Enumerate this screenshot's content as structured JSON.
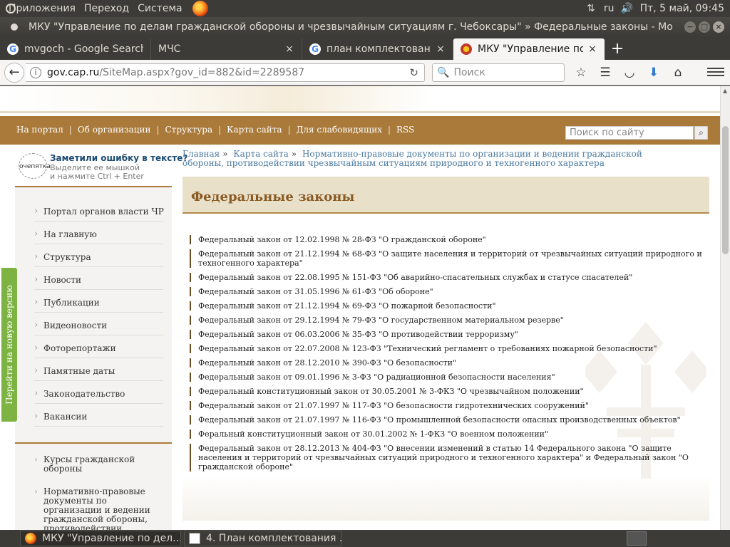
{
  "panel": {
    "menus": [
      "Приложения",
      "Переход",
      "Система"
    ],
    "lang": "ru",
    "datetime": "Пт, 5 май, 09:45"
  },
  "window": {
    "title": "МКУ \"Управление по делам гражданской обороны и чрезвычайным ситуациям г. Чебоксары\" » Федеральные законы - Mo"
  },
  "tabs": [
    {
      "label": "mvgoch - Google Search",
      "icon": "google-icon"
    },
    {
      "label": "МЧС",
      "icon": "none"
    },
    {
      "label": "план комплектования",
      "icon": "google-icon"
    },
    {
      "label": "МКУ \"Управление по делам",
      "icon": "crest-icon"
    }
  ],
  "nav": {
    "url_domain": "gov.cap.ru",
    "url_rest": "/SiteMap.aspx?gov_id=882&id=2289587",
    "search_placeholder": "Поиск"
  },
  "site": {
    "top_links": [
      "На портал",
      "Об организации",
      "Структура",
      "Карта сайта",
      "Для слабовидящих",
      "RSS"
    ],
    "search_placeholder": "Поиск по сайту",
    "orphus": {
      "logo": "очепятка",
      "title": "Заметили ошибку в тексте?",
      "line1": "Выделите ее мышкой",
      "line2": "и нажмите Ctrl + Enter"
    },
    "sidebar_items": [
      "Портал органов власти ЧР",
      "На главную",
      "Структура",
      "Новости",
      "Публикации",
      "Видеоновости",
      "Фоторепортажи",
      "Памятные даты",
      "Законодательство",
      "Вакансии"
    ],
    "sidebar_sub": [
      "Курсы гражданской обороны",
      "Нормативно-правовые документы по организации и ведении гражданской обороны, противодействии"
    ],
    "new_version": "Перейти на новую версию",
    "breadcrumb": {
      "home": "Главная",
      "sitemap": "Карта сайта",
      "section": "Нормативно-правовые документы по организации и ведении гражданской обороны, противодействии чрезвычайным ситуациям природного и техногенного характера"
    },
    "page_title": "Федеральные законы",
    "laws": [
      "Федеральный закон от 12.02.1998 № 28-ФЗ \"О гражданской обороне\"",
      "Федеральный закон от 21.12.1994 № 68-ФЗ \"О защите населения и территорий от чрезвычайных ситуаций природного и техногенного характера\"",
      "Федеральный закон от 22.08.1995 № 151-ФЗ \"Об аварийно-спасательных службах и статусе спасателей\"",
      "Федеральный закон от 31.05.1996 № 61-ФЗ \"Об обороне\"",
      "Федеральный закон от 21.12.1994 № 69-ФЗ \"О пожарной безопасности\"",
      "Федеральный закон от 29.12.1994 № 79-ФЗ \"О государственном материальном резерве\"",
      "Федеральный закон от 06.03.2006 № 35-ФЗ \"О противодействии терроризму\"",
      "Федеральный закон от 22.07.2008 № 123-ФЗ \"Технический регламент о требованиях пожарной безопасности\"",
      "Федеральный закон от 28.12.2010 № 390-ФЗ \"О безопасности\"",
      "Федеральный закон от 09.01.1996 № 3-ФЗ \"О радиационной безопасности населения\"",
      "Федеральный конституционный закон от 30.05.2001 № 3-ФКЗ \"О чрезвычайном положении\"",
      "Федеральный закон от 21.07.1997 № 117-ФЗ \"О безопасности гидротехнических сооружений\"",
      "Федеральный закон от 21.07.1997 № 116-ФЗ \"О промышленной безопасности опасных производственных объектов\"",
      "Феральный конституционный закон от 30.01.2002 № 1-ФКЗ \"О военном положении\"",
      "Федеральный закон от 28.12.2013 № 404-ФЗ \"О внесении изменений в статью 14 Федерального закона \"О защите населения и территорий от чрезвычайных ситуаций природного и техногенного характера\" и Федеральный закон \"О гражданской обороне\""
    ]
  },
  "taskbar": [
    {
      "label": "МКУ \"Управление по дел...",
      "icon": "firefox-icon"
    },
    {
      "label": "4. План комплектования ...",
      "icon": "document-icon"
    }
  ]
}
